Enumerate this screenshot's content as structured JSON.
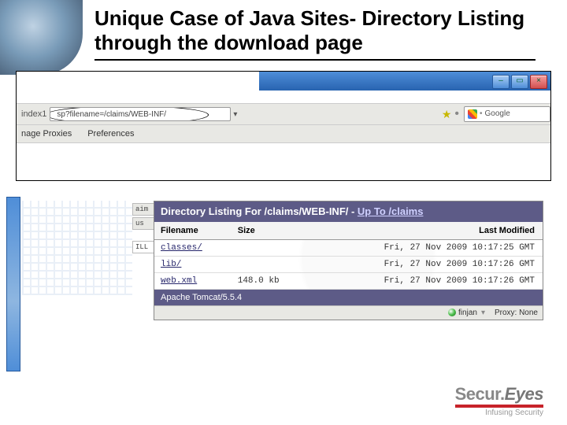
{
  "title": "Unique Case of Java Sites- Directory Listing through the download page",
  "browser": {
    "address_label": "index1",
    "url": "sp?filename=/claims/WEB-INF/",
    "search_label": "Google",
    "toolbar": {
      "proxies": "nage Proxies",
      "prefs": "Preferences"
    }
  },
  "sidebar_tabs": [
    "aim",
    "us",
    "ILL"
  ],
  "directory": {
    "heading_prefix": "Directory Listing For /claims/WEB-INF/ - ",
    "up_label": "Up To /claims",
    "columns": {
      "name": "Filename",
      "size": "Size",
      "mod": "Last Modified"
    },
    "rows": [
      {
        "name": "classes/",
        "size": "",
        "mod": "Fri, 27 Nov 2009 10:17:25 GMT"
      },
      {
        "name": "lib/",
        "size": "",
        "mod": "Fri, 27 Nov 2009 10:17:26 GMT"
      },
      {
        "name": "web.xml",
        "size": "148.0 kb",
        "mod": "Fri, 27 Nov 2009 10:17:26 GMT"
      }
    ],
    "server": "Apache Tomcat/5.5.4"
  },
  "status": {
    "finjan": "finjan",
    "proxy": "Proxy: None"
  },
  "footer": {
    "brand_a": "Secur.",
    "brand_b": "Eyes",
    "tagline": "Infusing Security"
  }
}
